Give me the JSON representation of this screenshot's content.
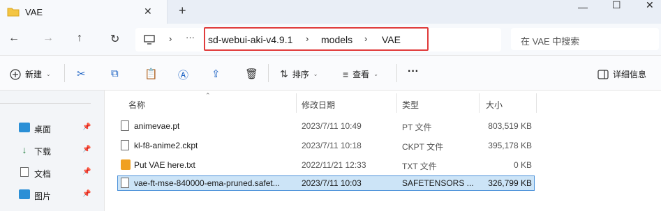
{
  "window": {
    "tab_title": "VAE",
    "close_tab": "✕",
    "new_tab": "+",
    "minimize": "—",
    "maximize": "☐",
    "close": "✕"
  },
  "nav": {
    "back": "←",
    "forward": "→",
    "up": "↑",
    "refresh": "↻",
    "more": "···",
    "breadcrumb": [
      "sd-webui-aki-v4.9.1",
      "models",
      "VAE"
    ],
    "separator": "›",
    "search_placeholder": "在 VAE 中搜索"
  },
  "toolbar": {
    "new_label": "新建",
    "sort_label": "排序",
    "view_label": "查看",
    "more": "···",
    "details_label": "详细信息"
  },
  "sidebar": {
    "items": [
      {
        "label": "桌面",
        "icon": "desktop-icon",
        "color": "#2b8fd6"
      },
      {
        "label": "下载",
        "icon": "download-icon",
        "color": "#1d7a3a"
      },
      {
        "label": "文档",
        "icon": "document-icon",
        "color": "#6a6a6a"
      },
      {
        "label": "图片",
        "icon": "picture-icon",
        "color": "#2b8fd6"
      }
    ],
    "pin": "📌"
  },
  "table": {
    "columns": [
      "名称",
      "修改日期",
      "类型",
      "大小"
    ],
    "rows": [
      {
        "name": "animevae.pt",
        "date": "2023/7/11 10:49",
        "type": "PT 文件",
        "size": "803,519 KB",
        "icon": "file-icon"
      },
      {
        "name": "kl-f8-anime2.ckpt",
        "date": "2023/7/11 10:18",
        "type": "CKPT 文件",
        "size": "395,178 KB",
        "icon": "file-icon"
      },
      {
        "name": "Put VAE here.txt",
        "date": "2022/11/21 12:33",
        "type": "TXT 文件",
        "size": "0 KB",
        "icon": "sublime-text-icon"
      },
      {
        "name": "vae-ft-mse-840000-ema-pruned.safet...",
        "date": "2023/7/11 10:03",
        "type": "SAFETENSORS ...",
        "size": "326,799 KB",
        "icon": "file-icon",
        "selected": true
      }
    ]
  },
  "colors": {
    "accent": "#1d63c4",
    "highlight_border": "#e03c3c",
    "selection": "#cce4f7"
  }
}
